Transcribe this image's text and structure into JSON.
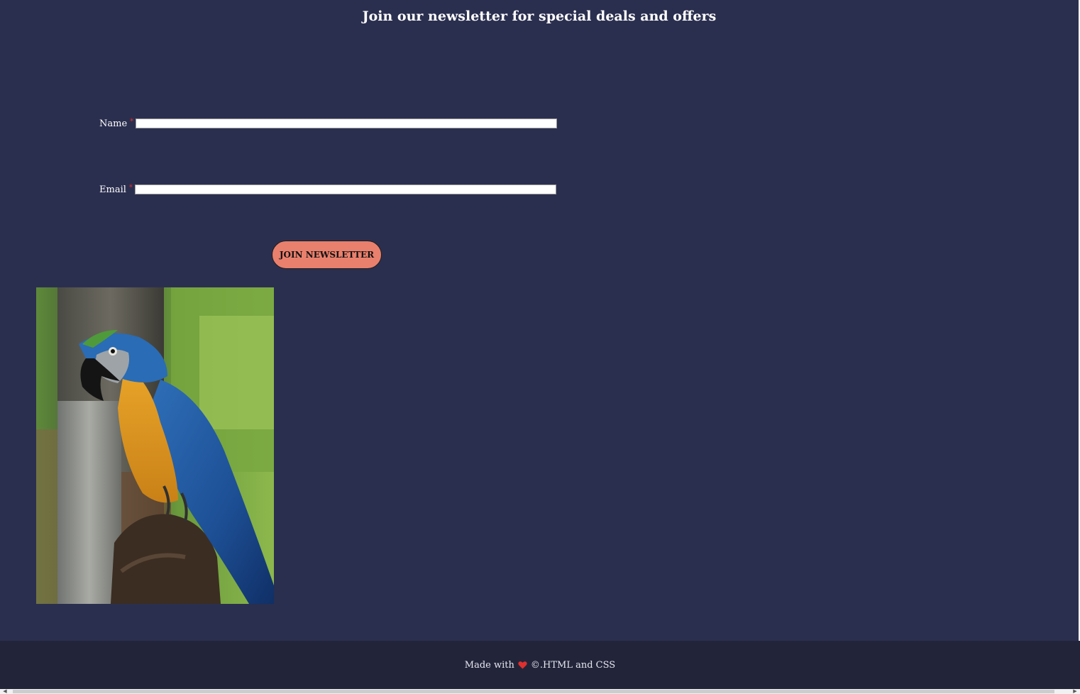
{
  "newsletter": {
    "heading": "Join our newsletter for special deals and offers",
    "fields": [
      {
        "label": "Name",
        "required_mark": "*",
        "value": ""
      },
      {
        "label": "Email",
        "required_mark": "*",
        "value": ""
      }
    ],
    "submit_label": "JOIN NEWSLETTER"
  },
  "image": {
    "icon": "macaw-parrot-photo"
  },
  "footer": {
    "text_before": "Made with",
    "icon": "heart-icon",
    "text_after": "©.HTML and CSS"
  },
  "colors": {
    "background": "#2b2f4f",
    "footer_background": "#22253a",
    "button": "#e9806d",
    "required": "#e0302e",
    "heart": "#e0302e"
  }
}
